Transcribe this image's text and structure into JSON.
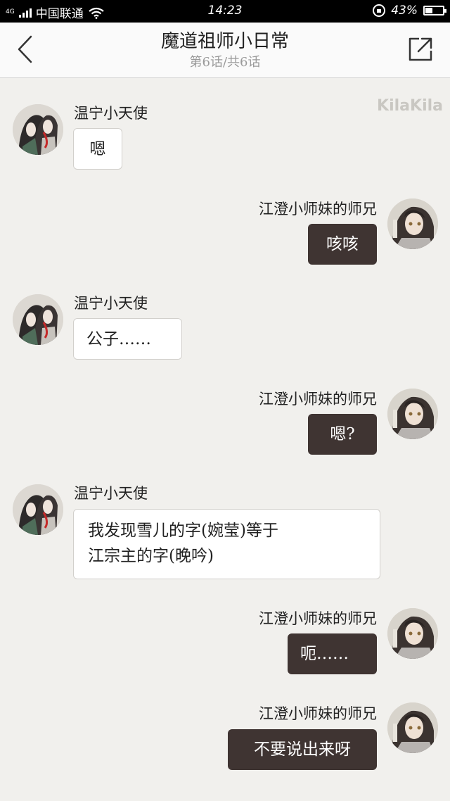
{
  "status": {
    "network": "4G",
    "carrier": "中国联通",
    "time": "14:23",
    "battery": "43%",
    "battery_level": 0.43,
    "icons": [
      "signal-icon",
      "wifi-icon",
      "rotation-lock-icon",
      "battery-icon"
    ]
  },
  "header": {
    "title": "魔道祖师小日常",
    "subtitle": "第6话/共6话",
    "back_icon": "chevron-left-icon",
    "share_icon": "share-icon"
  },
  "watermark": "KilaKila",
  "messages": [
    {
      "side": "left",
      "name": "温宁小天使",
      "text": "嗯"
    },
    {
      "side": "right",
      "name": "江澄小师妹的师兄",
      "text": "咳咳"
    },
    {
      "side": "left",
      "name": "温宁小天使",
      "text": "公子……"
    },
    {
      "side": "right",
      "name": "江澄小师妹的师兄",
      "text": "嗯?"
    },
    {
      "side": "left",
      "name": "温宁小天使",
      "text": "我发现雪儿的字(婉莹)等于",
      "text2": "江宗主的字(晚吟)"
    },
    {
      "side": "right",
      "name": "江澄小师妹的师兄",
      "text": "呃……"
    },
    {
      "side": "right",
      "name": "江澄小师妹的师兄",
      "text": "不要说出来呀"
    }
  ],
  "colors": {
    "background": "#f1f0ed",
    "outgoing_bubble": "#3f3432",
    "incoming_bubble": "#ffffff"
  }
}
